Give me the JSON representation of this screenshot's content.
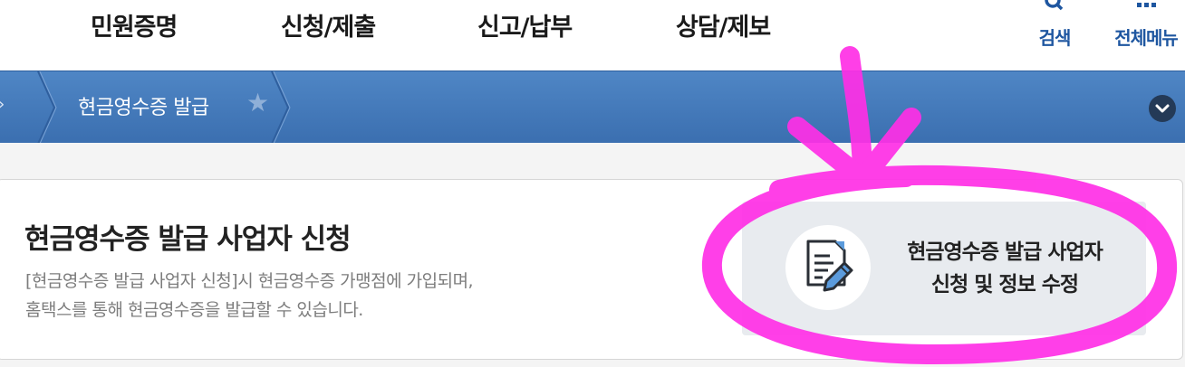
{
  "topnav": {
    "menu": [
      {
        "label": "민원증명"
      },
      {
        "label": "신청/제출"
      },
      {
        "label": "신고/납부"
      },
      {
        "label": "상담/제보"
      }
    ],
    "search_label": "검색",
    "allmenu_label": "전체메뉴"
  },
  "breadcrumb": {
    "current": "현금영수증 발급"
  },
  "card": {
    "title": "현금영수증 발급 사업자 신청",
    "description_lines": [
      "[현금영수증 발급 사업자 신청]시 현금영수증 가맹점에 가입되며,",
      "홈택스를 통해 현금영수증을 발급할 수 있습니다."
    ],
    "apply_button": {
      "icon": "document-edit-icon",
      "lines": [
        "현금영수증 발급 사업자",
        "신청 및 정보 수정"
      ]
    }
  },
  "colors": {
    "nav_accent": "#1e56a0",
    "breadcrumb_bar": "#4478b9",
    "annotation": "#ff2fe6",
    "button_bg": "#e8ebef"
  }
}
